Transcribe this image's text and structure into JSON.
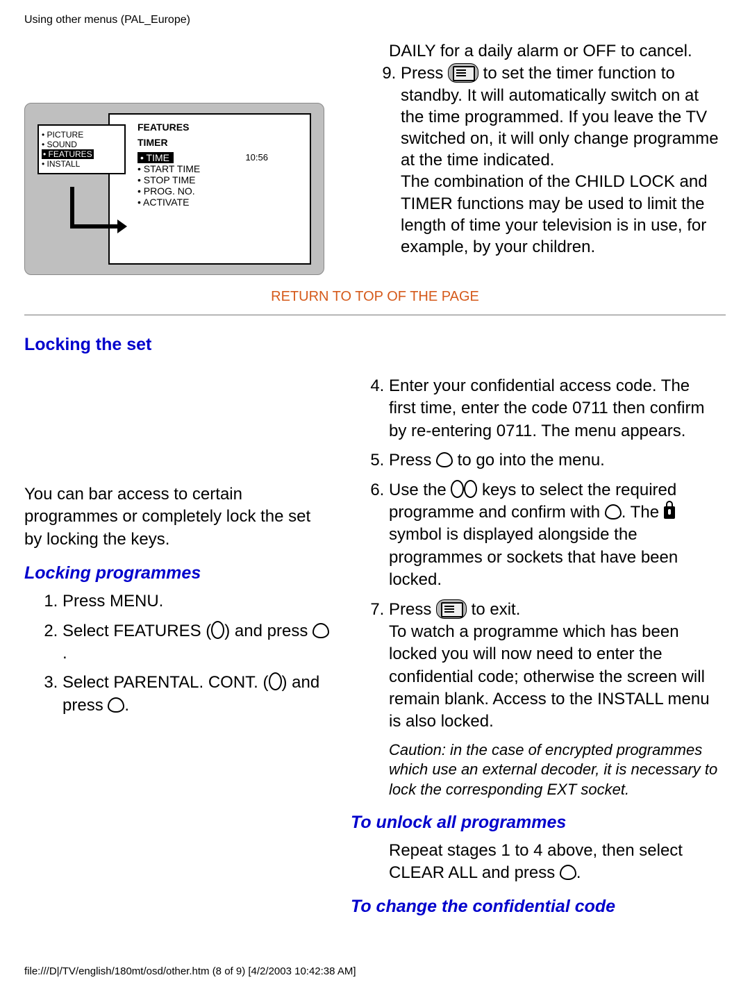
{
  "header": "Using other menus (PAL_Europe)",
  "osd": {
    "left": {
      "items": [
        "PICTURE",
        "SOUND",
        "FEATURES",
        "INSTALL"
      ],
      "selected": "FEATURES"
    },
    "right": {
      "title": "FEATURES",
      "subtitle": "TIMER",
      "selected": "TIME",
      "selected_value": "10:56",
      "items": [
        "START TIME",
        "STOP TIME",
        "PROG. NO.",
        "ACTIVATE"
      ]
    }
  },
  "top_text": "DAILY for a daily alarm or OFF to cancel.",
  "step9_a": "Press ",
  "step9_b": " to set the timer function to standby. It will automatically switch on at the time programmed. If you leave the TV switched on, it will only change programme at the time indicated.",
  "step9_c": "The combination of the CHILD LOCK and TIMER functions may be used to limit the length of time your television is in use, for example, by your children.",
  "return_link": "RETURN TO TOP OF THE PAGE",
  "section_title": "Locking the set",
  "intro_text": "You can bar access to certain programmes or completely lock the set by locking the keys.",
  "sub1": "Locking programmes",
  "left_steps": {
    "s1": "Press MENU.",
    "s2a": "Select FEATURES (",
    "s2b": ") and press ",
    "s2c": ".",
    "s3a": "Select PARENTAL. CONT. (",
    "s3b": ") and press ",
    "s3c": "."
  },
  "right_steps": {
    "s4": "Enter your confidential access code. The first time, enter the code 0711 then confirm by re-entering 0711. The menu appears.",
    "s5a": "Press ",
    "s5b": " to go into the menu.",
    "s6a": "Use the ",
    "s6b": " keys to select the required programme and confirm with ",
    "s6c": ". The ",
    "s6d": " symbol is displayed alongside the programmes or sockets that have been locked.",
    "s7a": "Press ",
    "s7b": " to exit.",
    "s7c": "To watch a programme which has been locked you will now need to enter the confidential code; otherwise the screen will remain blank. Access to the INSTALL menu is also locked."
  },
  "caution": "Caution: in the case of encrypted programmes which use an external decoder, it is necessary to lock the corresponding EXT socket.",
  "sub2": "To unlock all programmes",
  "unlock_a": "Repeat stages 1 to 4 above, then select CLEAR ALL and press ",
  "unlock_b": ".",
  "sub3": "To change the confidential code",
  "footer": "file:///D|/TV/english/180mt/osd/other.htm (8 of 9) [4/2/2003 10:42:38 AM]"
}
